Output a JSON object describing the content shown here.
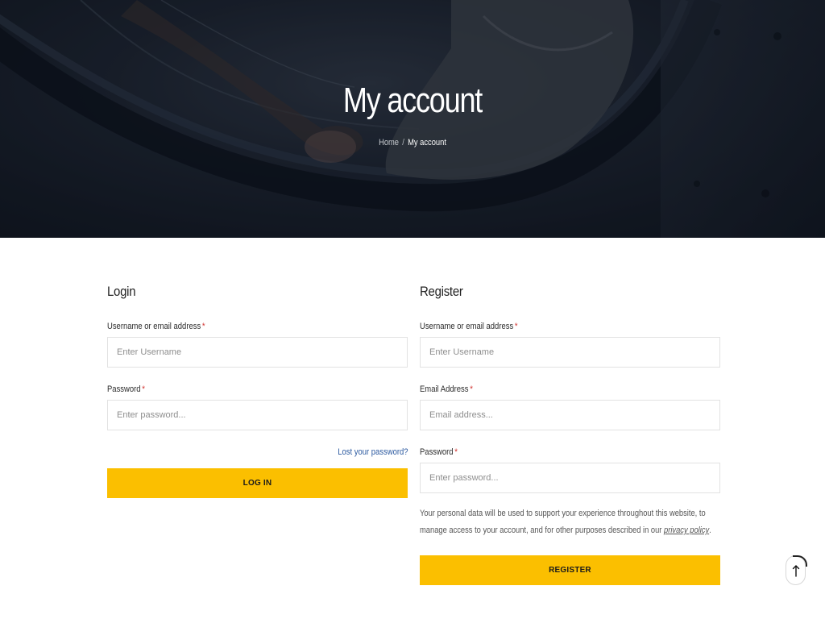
{
  "hero": {
    "title": "My account",
    "breadcrumb": {
      "home": "Home",
      "separator": "/",
      "current": "My account"
    }
  },
  "login": {
    "heading": "Login",
    "username_label": "Username or email address",
    "username_placeholder": "Enter Username",
    "password_label": "Password",
    "password_placeholder": "Enter password...",
    "required_mark": "*",
    "lost_password": "Lost your password?",
    "submit_label": "LOG IN"
  },
  "register": {
    "heading": "Register",
    "username_label": "Username or email address",
    "username_placeholder": "Enter Username",
    "email_label": "Email Address",
    "email_placeholder": "Email address...",
    "password_label": "Password",
    "password_placeholder": "Enter password...",
    "required_mark": "*",
    "privacy_text_before": "Your personal data will be used to support your experience throughout this website, to manage access to your account, and for other purposes described in our ",
    "privacy_link": "privacy policy",
    "privacy_text_after": ".",
    "submit_label": "REGISTER"
  },
  "scroll_top": {
    "icon": "arrow-up-icon"
  },
  "colors": {
    "accent": "#fbbf00",
    "link": "#2c5aa0",
    "required": "#d0312d",
    "hero_bg": "#161d27"
  }
}
